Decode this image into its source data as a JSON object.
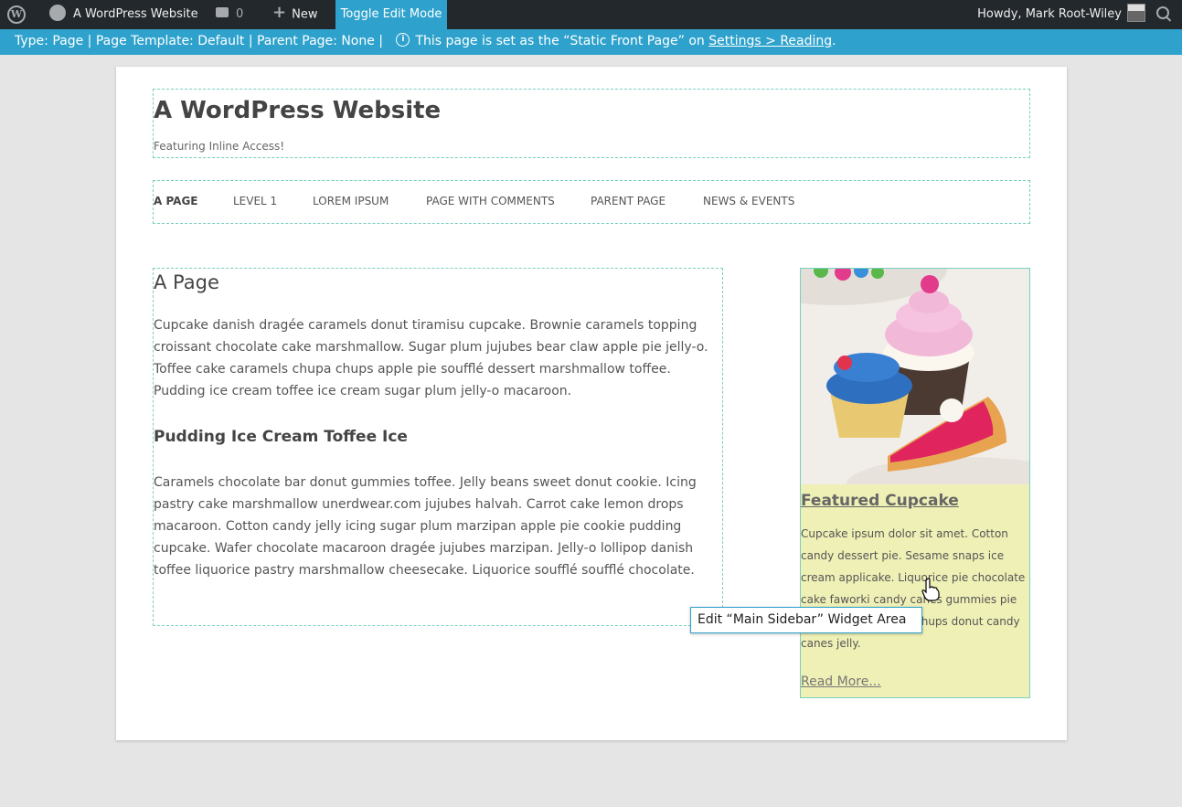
{
  "admin_bar": {
    "site_name": "A WordPress Website",
    "comments_count": "0",
    "new_label": "New",
    "toggle_label": "Toggle Edit Mode",
    "howdy": "Howdy, Mark Root-Wiley"
  },
  "info_bar": {
    "text": "Type: Page | Page Template: Default | Parent Page: None |",
    "notice_prefix": "This page is set as the “Static Front Page” on",
    "notice_link": "Settings > Reading",
    "notice_suffix": "."
  },
  "site": {
    "title": "A WordPress Website",
    "description": "Featuring Inline Access!"
  },
  "nav": {
    "items": [
      "A Page",
      "Level 1",
      "Lorem Ipsum",
      "Page with Comments",
      "Parent Page",
      "News & Events"
    ]
  },
  "content": {
    "title": "A Page",
    "para1": "Cupcake danish dragée caramels donut tiramisu cupcake. Brownie caramels topping croissant chocolate cake marshmallow. Sugar plum jujubes bear claw apple pie jelly-o. Toffee cake caramels chupa chups apple pie soufflé dessert marshmallow toffee. Pudding ice cream toffee ice cream sugar plum jelly-o macaroon.",
    "heading2": "Pudding Ice Cream Toffee Ice",
    "para2": "Caramels chocolate bar donut gummies toffee. Jelly beans sweet donut cookie. Icing pastry cake marshmallow unerdwear.com jujubes halvah. Carrot cake lemon drops macaroon. Cotton candy jelly icing sugar plum marzipan apple pie cookie pudding cupcake. Wafer chocolate macaroon dragée jujubes marzipan. Jelly-o lollipop danish toffee liquorice pastry marshmallow cheesecake. Liquorice soufflé soufflé chocolate."
  },
  "widget": {
    "title": "Featured Cupcake",
    "text": "Cupcake ipsum dolor sit amet. Cotton candy dessert pie. Sesame snaps ice cream applicake. Liquorice pie chocolate cake faworki candy canes gummies pie marshmallow chupa chups donut candy canes jelly.",
    "read_more": "Read More..."
  },
  "tooltip": "Edit “Main Sidebar” Widget Area",
  "colors": {
    "admin_bar": "#23282d",
    "accent": "#2ea2cc",
    "widget_bg": "#eff0b6",
    "dashed_outline": "#78cfc0"
  }
}
